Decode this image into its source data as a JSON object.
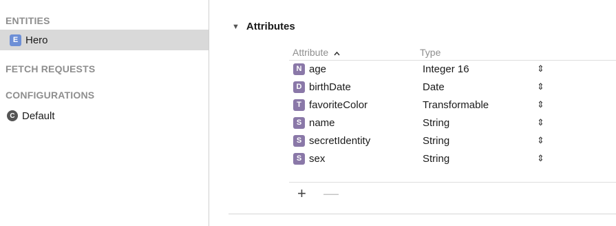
{
  "sidebar": {
    "entities_title": "ENTITIES",
    "entities": [
      {
        "badge": "E",
        "label": "Hero"
      }
    ],
    "fetch_requests_title": "FETCH REQUESTS",
    "configurations_title": "CONFIGURATIONS",
    "configurations": [
      {
        "badge": "C",
        "label": "Default"
      }
    ]
  },
  "main": {
    "section_title": "Attributes",
    "disclosure": "▼",
    "columns": {
      "attribute": "Attribute",
      "sort_indicator": "^",
      "type": "Type"
    },
    "rows": [
      {
        "badge": "N",
        "name": "age",
        "type": "Integer 16"
      },
      {
        "badge": "D",
        "name": "birthDate",
        "type": "Date"
      },
      {
        "badge": "T",
        "name": "favoriteColor",
        "type": "Transformable"
      },
      {
        "badge": "S",
        "name": "name",
        "type": "String"
      },
      {
        "badge": "S",
        "name": "secretIdentity",
        "type": "String"
      },
      {
        "badge": "S",
        "name": "sex",
        "type": "String"
      }
    ],
    "stepper_glyph": "⇕",
    "add_label": "+",
    "remove_label": "—"
  },
  "colors": {
    "entity_badge": "#6d8fd6",
    "attribute_badge": "#8a78a8",
    "selected_row": "#d9d9d9",
    "section_title_gray": "#8e8e8e"
  },
  "icons": {
    "entity": "entity-badge-icon",
    "configuration": "configuration-badge-icon",
    "attribute_type": "attribute-type-badge-icon",
    "stepper": "up-down-stepper-icon"
  }
}
